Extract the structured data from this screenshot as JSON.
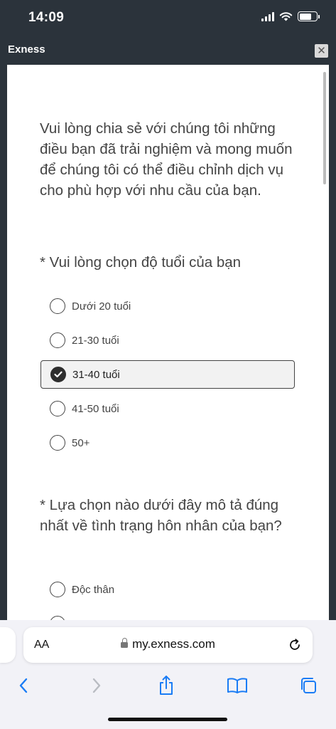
{
  "status_bar": {
    "time": "14:09"
  },
  "popup": {
    "title": "Exness",
    "close_symbol": "✕"
  },
  "survey": {
    "intro": "Vui lòng chia sẻ với chúng tôi những điều bạn đã trải nghiệm và mong muốn để chúng tôi có thể điều chỉnh dịch vụ cho phù hợp với nhu cầu của bạn.",
    "question_age": {
      "text": "* Vui lòng chọn độ tuổi của bạn",
      "options": [
        "Dưới 20 tuổi",
        "21-30 tuổi",
        "31-40 tuổi",
        "41-50 tuổi",
        "50+"
      ],
      "selected": "31-40 tuổi"
    },
    "question_marital": {
      "text": "* Lựa chọn nào dưới đây mô tả đúng nhất về tình trạng hôn nhân của bạn?",
      "options": [
        "Độc thân"
      ]
    }
  },
  "browser": {
    "text_size_label": "AA",
    "url": "my.exness.com",
    "icons": [
      "back-icon",
      "forward-icon",
      "share-icon",
      "bookmarks-icon",
      "tabs-icon",
      "reload-icon",
      "lock-icon"
    ]
  },
  "colors": {
    "chrome_dark": "#2b333b",
    "selected_bg": "#f2f2f2",
    "text": "#444444",
    "accent_blue": "#1a7cf5"
  }
}
